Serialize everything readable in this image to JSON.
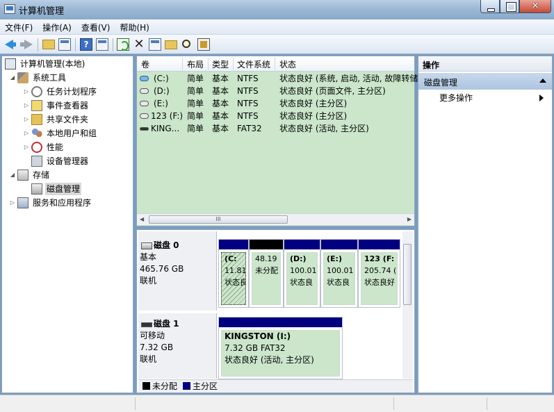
{
  "window": {
    "title": "计算机管理"
  },
  "menu": [
    "文件(F)",
    "操作(A)",
    "查看(V)",
    "帮助(H)"
  ],
  "tree": {
    "root": "计算机管理(本地)",
    "system_tools": "系统工具",
    "task_scheduler": "任务计划程序",
    "event_viewer": "事件查看器",
    "shared_folders": "共享文件夹",
    "local_users": "本地用户和组",
    "performance": "性能",
    "device_manager": "设备管理器",
    "storage": "存储",
    "disk_management": "磁盘管理",
    "services": "服务和应用程序"
  },
  "volumes": {
    "headers": [
      "卷",
      "布局",
      "类型",
      "文件系统",
      "状态"
    ],
    "rows": [
      [
        "(C:)",
        "简单",
        "基本",
        "NTFS",
        "状态良好 (系统, 启动, 活动, 故障转储"
      ],
      [
        "(D:)",
        "简单",
        "基本",
        "NTFS",
        "状态良好 (页面文件, 主分区)"
      ],
      [
        "(E:)",
        "简单",
        "基本",
        "NTFS",
        "状态良好 (主分区)"
      ],
      [
        "123 (F:)",
        "简单",
        "基本",
        "NTFS",
        "状态良好 (主分区)"
      ],
      [
        "KING...",
        "简单",
        "基本",
        "FAT32",
        "状态良好 (活动, 主分区)"
      ]
    ],
    "scroll_mark": "III"
  },
  "disks": [
    {
      "name": "磁盘 0",
      "type": "基本",
      "size": "465.76 GB",
      "status": "联机",
      "partitions": [
        {
          "title": "(C:",
          "size": "11.81",
          "status": "状态良"
        },
        {
          "title": "",
          "size": "48.19",
          "status": "未分配"
        },
        {
          "title": "(D:)",
          "size": "100.01",
          "status": "状态良"
        },
        {
          "title": "(E:)",
          "size": "100.01",
          "status": "状态良"
        },
        {
          "title": "123  (F:",
          "size": "205.74 (",
          "status": "状态良好"
        }
      ]
    },
    {
      "name": "磁盘 1",
      "type": "可移动",
      "size": "7.32 GB",
      "status": "联机",
      "partitions": [
        {
          "title": "KINGSTON  (I:)",
          "size": "7.32 GB FAT32",
          "status": "状态良好 (活动, 主分区)"
        }
      ]
    }
  ],
  "legend": {
    "unallocated": "未分配",
    "primary": "主分区"
  },
  "actions": {
    "header": "操作",
    "section": "磁盘管理",
    "more": "更多操作"
  },
  "colors": {
    "primary_partition": "#000080",
    "unallocated": "#000000",
    "volume_bg": "#cbe6cb"
  }
}
